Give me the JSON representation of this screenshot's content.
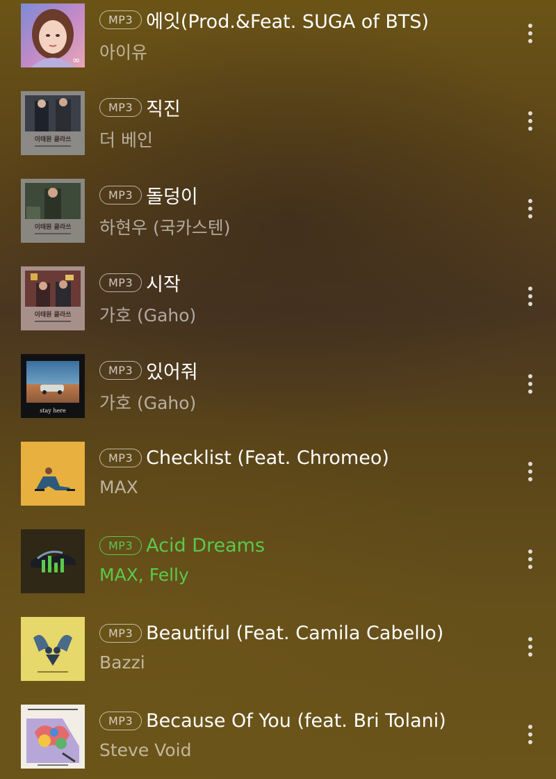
{
  "badge_label": "MP3",
  "colors": {
    "playing_accent": "#5bc94c",
    "background_top": "#6b5416",
    "background_mid": "#4a3620"
  },
  "tracks": [
    {
      "title": "에잇(Prod.&Feat. SUGA of BTS)",
      "artist": "아이유",
      "playing": false,
      "cover": "illustrated-girl-cover",
      "more_icon": "more-vertical-icon"
    },
    {
      "title": "직진",
      "artist": "더 베인",
      "playing": false,
      "cover": "itaewon-class-ost-cover",
      "more_icon": "more-vertical-icon"
    },
    {
      "title": "돌덩이",
      "artist": "하현우 (국카스텐)",
      "playing": false,
      "cover": "itaewon-class-ost-cover",
      "more_icon": "more-vertical-icon"
    },
    {
      "title": "시작",
      "artist": "가호 (Gaho)",
      "playing": false,
      "cover": "itaewon-class-ost-cover",
      "more_icon": "more-vertical-icon"
    },
    {
      "title": "있어줘",
      "artist": "가호 (Gaho)",
      "playing": false,
      "cover": "stay-here-cover",
      "more_icon": "more-vertical-icon"
    },
    {
      "title": "Checklist (Feat. Chromeo)",
      "artist": "MAX",
      "playing": false,
      "cover": "yellow-portrait-cover",
      "more_icon": "more-vertical-icon"
    },
    {
      "title": "Acid Dreams",
      "artist": "MAX, Felly",
      "playing": true,
      "cover": "now-playing-equalizer-icon",
      "more_icon": "more-vertical-icon"
    },
    {
      "title": "Beautiful (Feat. Camila Cabello)",
      "artist": "Bazzi",
      "playing": false,
      "cover": "angels-cover",
      "more_icon": "more-vertical-icon"
    },
    {
      "title": "Because Of You (feat. Bri Tolani)",
      "artist": "Steve Void",
      "playing": false,
      "cover": "colorful-collage-cover",
      "more_icon": "more-vertical-icon"
    }
  ],
  "cover_art_text": {
    "itaewon": "이태원 클라쓰",
    "stay_here": "stay here"
  }
}
